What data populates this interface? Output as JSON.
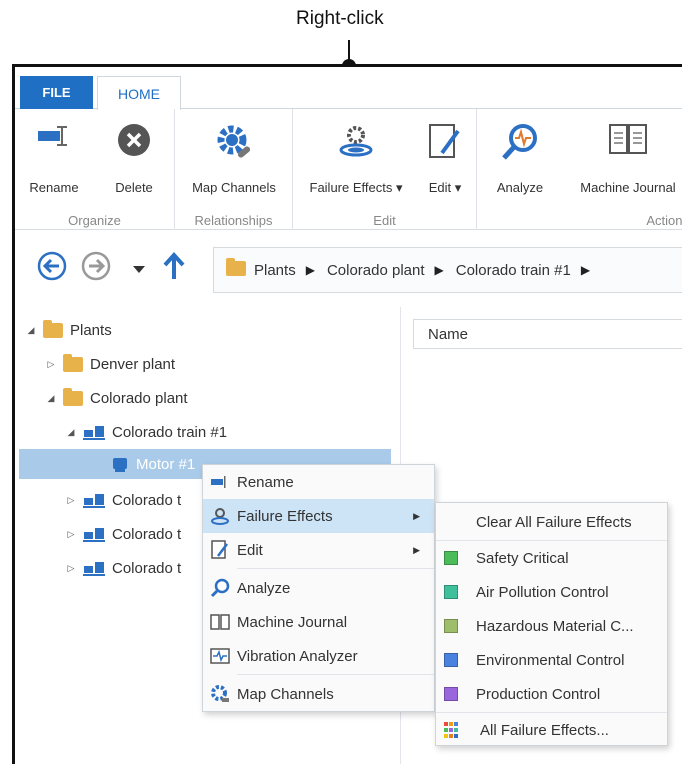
{
  "annotation": {
    "text": "Right-click"
  },
  "tabs": {
    "file": "FILE",
    "home": "HOME"
  },
  "ribbon": {
    "groups": [
      {
        "label": "Organize",
        "buttons": [
          "Rename",
          "Delete"
        ]
      },
      {
        "label": "Relationships",
        "buttons": [
          "Map Channels"
        ]
      },
      {
        "label": "Edit",
        "buttons": [
          "Failure Effects ▾",
          "Edit ▾"
        ]
      },
      {
        "label": "Actions",
        "buttons": [
          "Analyze",
          "Machine Journal"
        ]
      }
    ]
  },
  "breadcrumb": [
    "Plants",
    "Colorado plant",
    "Colorado train #1"
  ],
  "tree": [
    {
      "label": "Plants",
      "icon": "folder-icon",
      "expanded": true
    },
    {
      "label": "Denver plant",
      "icon": "folder-icon",
      "expanded": false
    },
    {
      "label": "Colorado plant",
      "icon": "folder-icon",
      "expanded": true
    },
    {
      "label": "Colorado train #1",
      "icon": "train-icon",
      "expanded": true
    },
    {
      "label": "Motor #1",
      "icon": "motor-icon",
      "selected": true
    },
    {
      "label": "Colorado t",
      "icon": "train-icon",
      "expanded": false
    },
    {
      "label": "Colorado t",
      "icon": "train-icon",
      "expanded": false
    },
    {
      "label": "Colorado t",
      "icon": "train-icon",
      "expanded": false
    }
  ],
  "grid": {
    "header": "Name"
  },
  "context_menu": [
    {
      "label": "Rename",
      "icon": "rename-icon"
    },
    {
      "label": "Failure Effects",
      "icon": "failure-effects-icon",
      "submenu": true,
      "highlighted": true
    },
    {
      "label": "Edit",
      "icon": "edit-icon",
      "submenu": true
    },
    {
      "label": "Analyze",
      "icon": "analyze-icon"
    },
    {
      "label": "Machine Journal",
      "icon": "journal-icon"
    },
    {
      "label": "Vibration Analyzer",
      "icon": "vibration-icon"
    },
    {
      "label": "Map Channels",
      "icon": "map-channels-icon"
    }
  ],
  "submenu": {
    "clear": "Clear All Failure Effects",
    "items": [
      {
        "label": "Safety Critical",
        "color": "#4cbb5a"
      },
      {
        "label": "Air Pollution Control",
        "color": "#3fbf9c"
      },
      {
        "label": "Hazardous Material C...",
        "color": "#9fbe6b"
      },
      {
        "label": "Environmental Control",
        "color": "#4a82e0"
      },
      {
        "label": "Production Control",
        "color": "#9966dd"
      }
    ],
    "all": "All Failure Effects..."
  }
}
